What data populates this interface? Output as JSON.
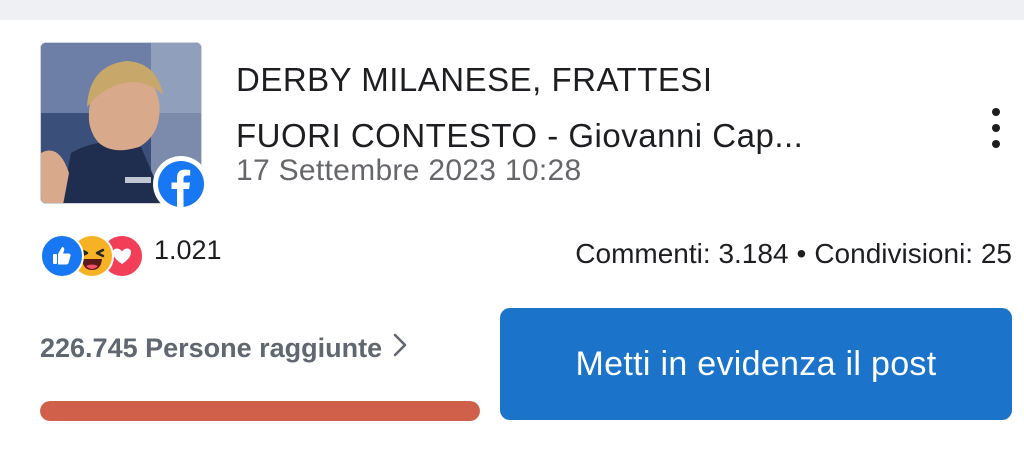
{
  "post": {
    "title_line1": "DERBY MILANESE, FRATTESI",
    "title_line2": "FUORI CONTESTO - Giovanni Cap...",
    "date": "17 Settembre 2023 10:28",
    "source_icon": "facebook-icon"
  },
  "reactions": {
    "icons": [
      "like-icon",
      "haha-icon",
      "love-icon"
    ],
    "count": "1.021"
  },
  "stats": {
    "comments_label": "Commenti: 3.184",
    "separator": "•",
    "shares_label": "Condivisioni: 25"
  },
  "reach": {
    "label": "226.745 Persone raggiunte",
    "progress": 1.0
  },
  "boost": {
    "label": "Metti in evidenza il post"
  },
  "colors": {
    "facebook_blue": "#1877f2",
    "boost_button": "#1b74c9",
    "progress_fill": "#d0604a",
    "secondary_text": "#65676b"
  }
}
